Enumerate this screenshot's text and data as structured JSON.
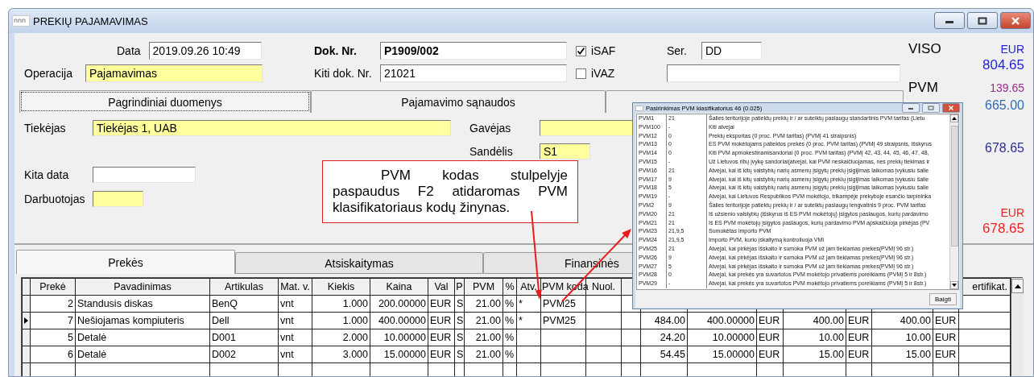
{
  "window": {
    "title": "PREKIŲ  PAJAMAVIMAS"
  },
  "header": {
    "date_label": "Data",
    "date": "2019.09.26 10:49",
    "operation_label": "Operacija",
    "operation": "Pajamavimas",
    "doc_no_label": "Dok. Nr.",
    "doc_no": "P1909/002",
    "other_doc_label": "Kiti dok. Nr.",
    "other_doc": "21021",
    "checkboxes": [
      {
        "label": "iSAF",
        "checked": true
      },
      {
        "label": "iVAZ",
        "checked": false
      }
    ],
    "series_label": "Ser.",
    "series": "DD"
  },
  "totals": [
    {
      "label": "VISO",
      "currency": "EUR",
      "amount": "804.65",
      "color": "#2222dd"
    },
    {
      "label": "PVM",
      "amount": "139.65",
      "color": "#9a2d8e"
    },
    {
      "amount": "665.00",
      "color": "#2f6db5"
    },
    {
      "amount": "678.65",
      "color": "#2d2d8f"
    },
    {
      "currency": "EUR",
      "amount": "678.65",
      "color": "#ee2222"
    }
  ],
  "upper_tabs": [
    {
      "label": "Pagrindiniai duomenys",
      "selected": true
    },
    {
      "label": "Pajamavimo sąnaudos",
      "selected": false
    }
  ],
  "main": {
    "supplier_label": "Tiekėjas",
    "supplier": "Tiekėjas 1, UAB",
    "recipient_label": "Gavėjas",
    "warehouse_label": "Sandėlis",
    "warehouse": "S1",
    "other_date_label": "Kita data",
    "employee_label": "Darbuotojas"
  },
  "lower_tabs": [
    {
      "label": "Prekės",
      "selected": true
    },
    {
      "label": "Atsiskaitymas",
      "selected": false
    },
    {
      "label": "Finansinės",
      "selected": false
    }
  ],
  "table": {
    "columns": [
      "Prekė",
      "Pavadinimas",
      "Artikulas",
      "Mat. v.",
      "Kiekis",
      "Kaina",
      "Val",
      "P",
      "PVM",
      "%",
      "Atv.",
      "PVM koda",
      "Nuol.",
      null,
      null,
      null,
      null,
      null,
      null,
      null,
      null,
      "ertifikat."
    ],
    "rows": [
      {
        "current": false,
        "cells": [
          "2",
          "Standusis diskas",
          "BenQ",
          "vnt",
          "1.000",
          "200.00000",
          "EUR",
          "S",
          "21.00",
          "%",
          "*",
          "PVM25",
          null,
          null,
          null,
          null,
          null,
          null,
          null,
          null,
          null,
          null
        ]
      },
      {
        "current": true,
        "cells": [
          "7",
          "Nešiojamas kompiuteris",
          "Dell",
          "vnt",
          "1.000",
          "400.00000",
          "EUR",
          "S",
          "21.00",
          "%",
          "*",
          "PVM25",
          null,
          null,
          "484.00",
          "400.00000",
          "EUR",
          "400.00",
          "EUR",
          "400.00",
          "EUR",
          null
        ]
      },
      {
        "current": false,
        "cells": [
          "5",
          "Detalė",
          "D001",
          "vnt",
          "2.000",
          "10.00000",
          "EUR",
          "S",
          "21.00",
          "%",
          null,
          null,
          null,
          null,
          "24.20",
          "10.00000",
          "EUR",
          "10.00",
          "EUR",
          "10.00",
          "EUR",
          null
        ]
      },
      {
        "current": false,
        "cells": [
          "6",
          "Detalė",
          "D002",
          "vnt",
          "3.000",
          "15.00000",
          "EUR",
          "S",
          "21.00",
          "%",
          null,
          null,
          null,
          null,
          "54.45",
          "15.00000",
          "EUR",
          "15.00",
          "EUR",
          "15.00",
          "EUR",
          null
        ]
      }
    ]
  },
  "callout": {
    "text": "PVM kodas stulpelyje paspaudus F2 atidaromas PVM klasifikatoriaus kodų žinynas."
  },
  "popup": {
    "title": "Pasirinkimas  PVM klasifikatorius  46  (0.025)",
    "button": "Baigti",
    "rows": [
      {
        "code": "PVM1",
        "rate": "21",
        "description": "Šalies teritorijoje patiektų prekių ir / ar suteiktų paslaugų standartinis PVM tarifas  (Lietu"
      },
      {
        "code": "PVM100",
        "rate": "-",
        "description": "Kiti atvejai"
      },
      {
        "code": "PVM12",
        "rate": "0",
        "description": "Prekių eksportas (0 proc. PVM tarifas) (PVMĮ 41 straipsnis)"
      },
      {
        "code": "PVM13",
        "rate": "0",
        "description": "ES PVM mokėtojams patiektos prekės (0 proc. PVM tarifas) (PVMĮ 49 straipsnis, išskyrus"
      },
      {
        "code": "PVM14",
        "rate": "0",
        "description": "Kiti PVM apmokestinamisandoriai (0 proc. PVM tarifas) (PVMĮ 42, 43, 44, 45, 46, 47, 48,"
      },
      {
        "code": "PVM15",
        "rate": "-",
        "description": "Už Lietuvos ribų įvykę sandoriai(atvejai, kai PVM neskaičiuojamas, nes prekių tiekimas ir"
      },
      {
        "code": "PVM16",
        "rate": "21",
        "description": "Atvejai, kai iš kitų valstybių narių asmenų įsigytų prekių įsigijimas laikomas įvykusiu šalie"
      },
      {
        "code": "PVM17",
        "rate": "9",
        "description": "Atvejai, kai iš kitų valstybių narių asmenų įsigytų prekių įsigijimas laikomas įvykusiu šalie"
      },
      {
        "code": "PVM18",
        "rate": "5",
        "description": "Atvejai, kai iš kitų valstybių narių asmenų įsigytų prekių įsigijimas laikomas įvykusiu šalie"
      },
      {
        "code": "PVM19",
        "rate": "-",
        "description": "Atvejai, kai Lietuvos Respublikos PVM mokėtojo, trikampėje prekyboje esančio tarpininka"
      },
      {
        "code": "PVM2",
        "rate": "9",
        "description": "Šalies teritorijoje patiektų prekių ir / ar suteiktų paslaugų lengvatinis 9 proc. PVM tarifas"
      },
      {
        "code": "PVM20",
        "rate": "21",
        "description": "Iš užsienio valstybių (išskyrus iš ES PVM mokėtojų) įsigytos paslaugos, kurių pardavimo"
      },
      {
        "code": "PVM21",
        "rate": "21",
        "description": "Iš ES PVM mokėtojų įsigytos paslaugos, kurių pardavimo PVM apskaičiuoja pirkėjas (PV"
      },
      {
        "code": "PVM23",
        "rate": "21,9,5",
        "description": "Sumokėtas importo PVM"
      },
      {
        "code": "PVM24",
        "rate": "21,9,5",
        "description": "Importo PVM, kurio įskaitymą kontroliuoja VMI"
      },
      {
        "code": "PVM25",
        "rate": "21",
        "description": "Atvejai, kai pirkėjas išskaito ir sumoka PVM už jam tiekiamas prekes(PVMĮ 96 str.)"
      },
      {
        "code": "PVM26",
        "rate": "9",
        "description": "Atvejai, kai pirkėjas išskaito ir sumoka PVM už jam tiekiamas prekes(PVMĮ 96 str.)"
      },
      {
        "code": "PVM27",
        "rate": "5",
        "description": "Atvejai, kai pirkėjas išskaito ir sumoka PVM už jam tiekiamas prekes(PVMĮ 96 str.)"
      },
      {
        "code": "PVM28",
        "rate": "0",
        "description": "Atvejai, kai prekės yra suvartotos PVM mokėtojo privatiems poreikiams (PVMĮ 5 ir 8str.)"
      },
      {
        "code": "PVM29",
        "rate": "-",
        "description": "Atvejai, kai prekės yra suvartotos PVM mokėtojo privatiems poreikiams (PVMĮ 5 ir 8str.)"
      }
    ]
  }
}
